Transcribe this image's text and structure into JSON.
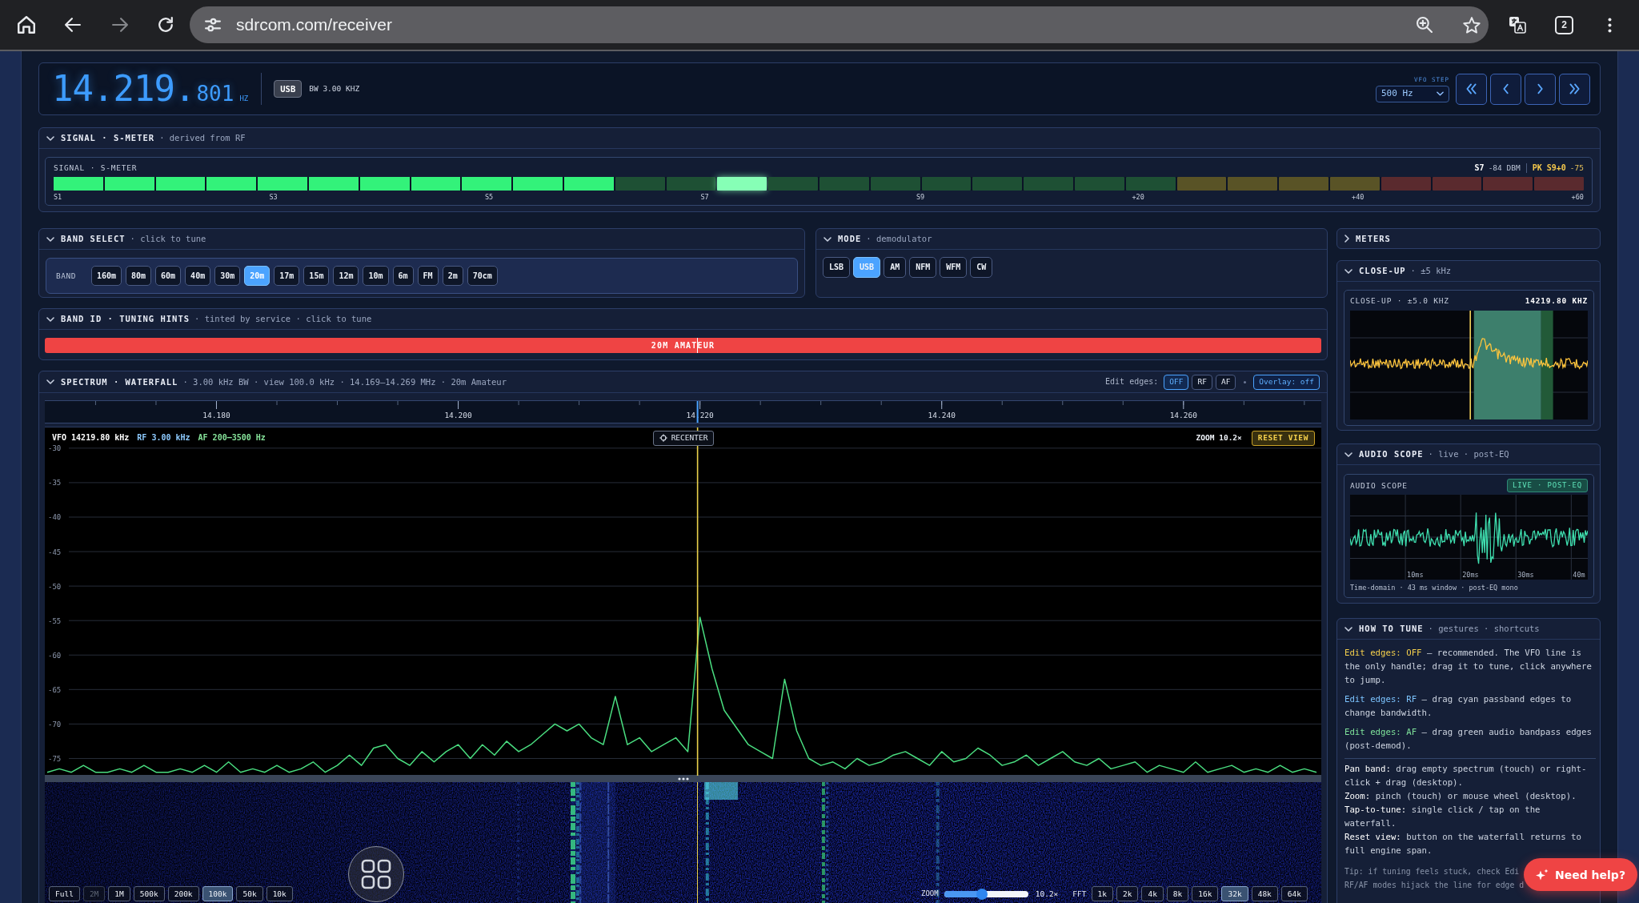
{
  "browser": {
    "url": "sdrcom.com/receiver",
    "tab_count": "2",
    "back": {
      "disabled": false
    },
    "forward": {
      "disabled": true
    }
  },
  "vfo": {
    "frequency_main": "14.219.",
    "frequency_fine": "801",
    "unit": "HZ",
    "mode": "USB",
    "bandwidth": "BW 3.00 KHZ",
    "step_label": "VFO STEP",
    "step": "500 Hz"
  },
  "s_meter": {
    "title": "SIGNAL · S-METER",
    "subtitle": "· derived from RF",
    "expanded": true,
    "label": "SIGNAL · S-METER",
    "s_reading": "S7",
    "dbm_reading": "-84 DBM",
    "peak_label": "PK S9+0",
    "peak_reading": "-75",
    "level": 0.367,
    "peak": {
      "level": 0.45
    },
    "scale": [
      "S1",
      "S3",
      "S5",
      "S7",
      "S9",
      "+20",
      "+40",
      "+60"
    ]
  },
  "band_select": {
    "title": "BAND SELECT",
    "subtitle": "· click to tune",
    "expanded": true,
    "label": "BAND",
    "bands": [
      {
        "label": "160m",
        "selected": false
      },
      {
        "label": "80m",
        "selected": false
      },
      {
        "label": "60m",
        "selected": false
      },
      {
        "label": "40m",
        "selected": false
      },
      {
        "label": "30m",
        "selected": false
      },
      {
        "label": "20m",
        "selected": true
      },
      {
        "label": "17m",
        "selected": false
      },
      {
        "label": "15m",
        "selected": false
      },
      {
        "label": "12m",
        "selected": false
      },
      {
        "label": "10m",
        "selected": false
      },
      {
        "label": "6m",
        "selected": false
      },
      {
        "label": "FM",
        "selected": false
      },
      {
        "label": "2m",
        "selected": false
      },
      {
        "label": "70cm",
        "selected": false
      }
    ]
  },
  "mode": {
    "title": "MODE",
    "subtitle": "· demodulator",
    "expanded": true,
    "modes": [
      {
        "label": "LSB",
        "selected": false
      },
      {
        "label": "USB",
        "selected": true
      },
      {
        "label": "AM",
        "selected": false
      },
      {
        "label": "NFM",
        "selected": false
      },
      {
        "label": "WFM",
        "selected": false
      },
      {
        "label": "CW",
        "selected": false
      }
    ]
  },
  "band_id": {
    "title": "BAND ID · TUNING HINTS",
    "subtitle": "· tinted by service · click to tune",
    "expanded": true,
    "segments": [
      {
        "label": "20M AMATEUR",
        "color": "#ef4444"
      }
    ]
  },
  "spectrum": {
    "title": "SPECTRUM · WATERFALL",
    "subtitle": "· 3.00 kHz BW · view 100.0 kHz · 14.169–14.269 MHz · 20m Amateur",
    "expanded": true,
    "edit_edges_label": "Edit edges:",
    "edit_edges": [
      {
        "label": "OFF",
        "selected": true
      },
      {
        "label": "RF",
        "selected": false
      },
      {
        "label": "AF",
        "selected": false
      }
    ],
    "overlay_button": "Overlay: off",
    "readouts": [
      {
        "label": "VFO 14219.80 kHz",
        "color": "#ffffff"
      },
      {
        "label": "RF 3.00 kHz",
        "color": "#8ecbff"
      },
      {
        "label": "AF 200–3500 Hz",
        "color": "#86e39a"
      }
    ],
    "recenter_button": "RECENTER",
    "zoom_readout": "ZOOM 10.2×",
    "reset_button": "RESET VIEW",
    "chart_data": {
      "type": "line",
      "x": [
        14.166,
        14.167,
        14.168,
        14.169,
        14.17,
        14.171,
        14.172,
        14.173,
        14.174,
        14.175,
        14.176,
        14.177,
        14.178,
        14.179,
        14.18,
        14.181,
        14.182,
        14.183,
        14.184,
        14.185,
        14.186,
        14.187,
        14.188,
        14.189,
        14.19,
        14.191,
        14.192,
        14.193,
        14.194,
        14.195,
        14.196,
        14.197,
        14.198,
        14.199,
        14.2,
        14.201,
        14.202,
        14.203,
        14.204,
        14.205,
        14.206,
        14.207,
        14.208,
        14.209,
        14.21,
        14.211,
        14.212,
        14.213,
        14.214,
        14.215,
        14.216,
        14.217,
        14.218,
        14.219,
        14.22,
        14.221,
        14.222,
        14.223,
        14.224,
        14.225,
        14.226,
        14.227,
        14.228,
        14.229,
        14.23,
        14.231,
        14.232,
        14.233,
        14.234,
        14.235,
        14.236,
        14.237,
        14.238,
        14.239,
        14.24,
        14.241,
        14.242,
        14.243,
        14.244,
        14.245,
        14.246,
        14.247,
        14.248,
        14.249,
        14.25,
        14.251,
        14.252,
        14.253,
        14.254,
        14.255,
        14.256,
        14.257,
        14.258,
        14.259,
        14.26,
        14.261,
        14.262,
        14.263,
        14.264,
        14.265,
        14.266,
        14.267,
        14.268,
        14.269,
        14.27,
        14.271
      ],
      "values": [
        -77,
        -76.5,
        -77,
        -76,
        -77,
        -77,
        -76.5,
        -77,
        -76,
        -77,
        -77,
        -76.5,
        -77,
        -76,
        -77,
        -75.5,
        -77,
        -76.5,
        -77,
        -76,
        -77,
        -76.5,
        -75.5,
        -77,
        -76,
        -74.5,
        -76,
        -73.5,
        -73,
        -75,
        -76,
        -74,
        -75.5,
        -74,
        -73,
        -75,
        -73,
        -74.5,
        -72.5,
        -74,
        -73,
        -71.5,
        -70,
        -71,
        -70,
        -72,
        -73,
        -66,
        -73,
        -72,
        -74,
        -73,
        -72,
        -74,
        -54.5,
        -62,
        -68,
        -70.5,
        -73,
        -74,
        -75,
        -63.5,
        -71,
        -75,
        -76,
        -75.5,
        -76.5,
        -75,
        -76,
        -75.5,
        -74.5,
        -74,
        -75,
        -76,
        -74,
        -75.5,
        -75,
        -73.5,
        -74.5,
        -76,
        -75.5,
        -74.5,
        -76,
        -75,
        -74,
        -75.5,
        -76,
        -75,
        -76.5,
        -76,
        -75.5,
        -77,
        -76,
        -76.5,
        -77,
        -75.5,
        -77,
        -76.5,
        -76,
        -77,
        -76.5,
        -77,
        -76,
        -77,
        -76.5,
        -77
      ],
      "xlim": [
        14.1658,
        14.2714
      ],
      "ylim": [
        -77.5,
        -27
      ],
      "xticks": [
        {
          "value": 14.18,
          "label": "14.180"
        },
        {
          "value": 14.2,
          "label": "14.200"
        },
        {
          "value": 14.22,
          "label": "14.220"
        },
        {
          "value": 14.24,
          "label": "14.240"
        },
        {
          "value": 14.26,
          "label": "14.260"
        }
      ],
      "yticks": [
        -30,
        -35,
        -40,
        -45,
        -50,
        -55,
        -60,
        -65,
        -70,
        -75
      ],
      "grid": true,
      "ref_lines": [
        {
          "axis": "x",
          "value": 14.2198
        }
      ]
    },
    "spans": [
      {
        "label": "Full",
        "selected": false,
        "disabled": false
      },
      {
        "label": "2M",
        "selected": false,
        "disabled": true
      },
      {
        "label": "1M",
        "selected": false,
        "disabled": false
      },
      {
        "label": "500k",
        "selected": false,
        "disabled": false
      },
      {
        "label": "200k",
        "selected": false,
        "disabled": false
      },
      {
        "label": "100k",
        "selected": true,
        "disabled": false
      },
      {
        "label": "50k",
        "selected": false,
        "disabled": false
      },
      {
        "label": "10k",
        "selected": false,
        "disabled": false
      }
    ],
    "zoom_label": "ZOOM",
    "zoom_slider": {
      "level": 0.45
    },
    "zoom_value": "10.2×",
    "fft_label": "FFT",
    "fft_sizes": [
      {
        "label": "1k",
        "selected": false
      },
      {
        "label": "2k",
        "selected": false
      },
      {
        "label": "4k",
        "selected": false
      },
      {
        "label": "8k",
        "selected": false
      },
      {
        "label": "16k",
        "selected": false
      },
      {
        "label": "32k",
        "selected": true
      },
      {
        "label": "48k",
        "selected": false
      },
      {
        "label": "64k",
        "selected": false
      }
    ]
  },
  "meters": {
    "title": "METERS",
    "expanded": false
  },
  "close_up": {
    "title": "CLOSE-UP",
    "subtitle": "· ±5 kHz",
    "expanded": true,
    "label": "CLOSE-UP · ±5.0 KHZ",
    "frequency": "14219.80 KHZ"
  },
  "audio_scope": {
    "title": "AUDIO SCOPE",
    "subtitle": "· live · post-EQ",
    "expanded": true,
    "label": "AUDIO SCOPE",
    "badge": "LIVE · POST-EQ",
    "time_ticks": [
      "10ms",
      "20ms",
      "30ms",
      "40m"
    ],
    "caption": "Time-domain · 43 ms window · post-EQ mono"
  },
  "how_to_tune": {
    "title": "HOW TO TUNE",
    "subtitle": "· gestures · shortcuts",
    "expanded": true,
    "edge_modes": [
      {
        "key": "Edit edges: OFF",
        "text": "— recommended. The VFO line is the only handle; drag it to tune, click anywhere to jump.",
        "color": "#f5d04c"
      },
      {
        "key": "Edit edges: RF",
        "text": "— drag cyan passband edges to change bandwidth.",
        "color": "#7cc4ff"
      },
      {
        "key": "Edit edges: AF",
        "text": "— drag green audio bandpass edges (post-demod).",
        "color": "#7ee29a"
      }
    ],
    "gestures": [
      {
        "key": "Pan band:",
        "text": "drag empty spectrum (touch) or right-click + drag (desktop)."
      },
      {
        "key": "Zoom:",
        "text": "pinch (touch) or mouse wheel (desktop)."
      },
      {
        "key": "Tap-to-tune:",
        "text": "single click / tap on the waterfall."
      },
      {
        "key": "Reset view:",
        "text": "button on the waterfall returns to full engine span."
      }
    ],
    "tip_lines": [
      "Tip: if tuning feels stuck, check Edi",
      "RF/AF modes hijack the line for edge d"
    ]
  },
  "help_button": "Need help?"
}
